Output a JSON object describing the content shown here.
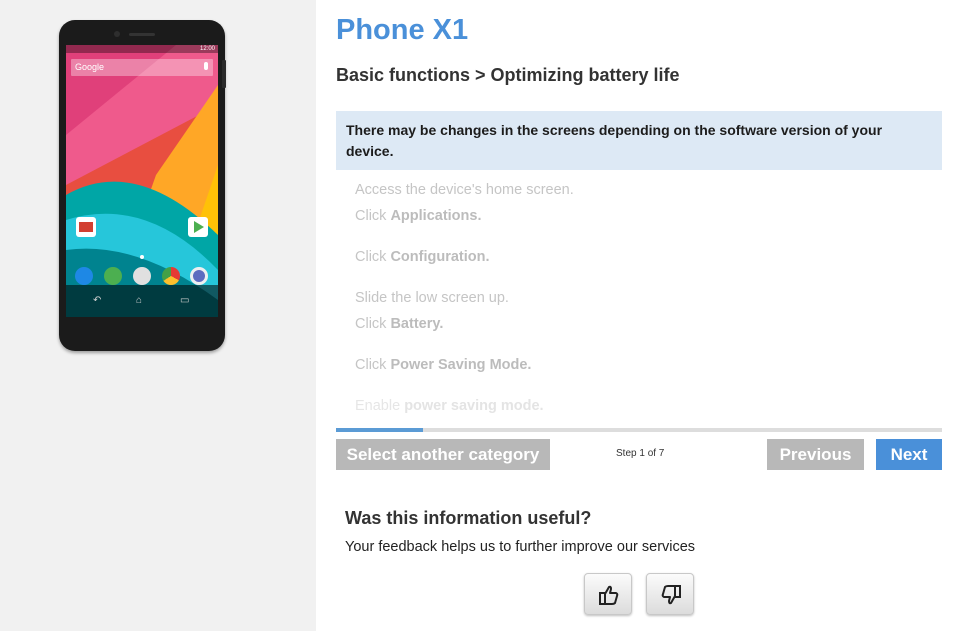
{
  "phone": {
    "status_time": "12:00",
    "search_label": "Google"
  },
  "header": {
    "title": "Phone X1",
    "breadcrumb": "Basic functions > Optimizing battery life"
  },
  "notice": {
    "text": "There may be changes in the screens depending on the software version of your device."
  },
  "steps": {
    "s1_line1": "Access the device's home screen.",
    "s1_line2_prefix": "Click ",
    "s1_line2_bold": "Applications.",
    "s2_prefix": "Click ",
    "s2_bold": "Configuration.",
    "s3_line1": "Slide the low screen up.",
    "s3_line2_prefix": "Click ",
    "s3_line2_bold": "Battery.",
    "s4_prefix": "Click ",
    "s4_bold": "Power Saving Mode.",
    "s5_prefix": "Enable ",
    "s5_bold": "power saving mode."
  },
  "progress": {
    "current_step": 1,
    "total_steps": 7,
    "fraction": 0.143
  },
  "navigation": {
    "select_category_label": "Select another category",
    "step_indicator": "Step 1 of 7",
    "previous_label": "Previous",
    "next_label": "Next"
  },
  "feedback": {
    "question": "Was this information useful?",
    "subtitle": "Your feedback helps us to further improve our services",
    "thumbs_up_icon": "thumbs-up-icon",
    "thumbs_down_icon": "thumbs-down-icon"
  },
  "colors": {
    "accent": "#4a90d9",
    "notice_bg": "#dde9f5",
    "button_grey": "#b8b8b8"
  }
}
